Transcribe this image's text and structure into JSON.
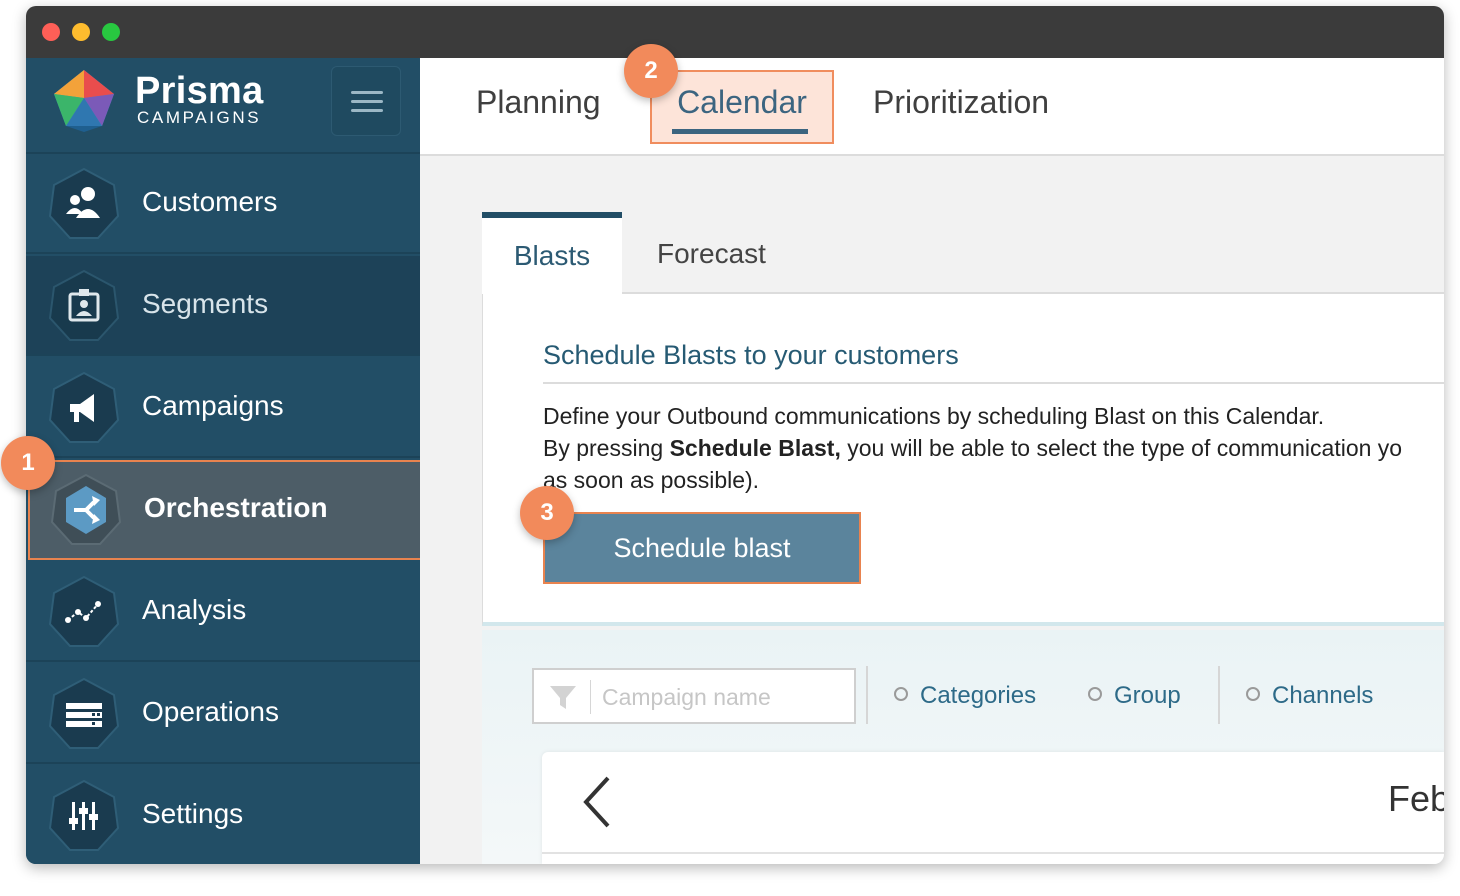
{
  "app": {
    "brand_name": "Prisma",
    "brand_sub": "CAMPAIGNS",
    "colors": {
      "sidebar": "#224e66",
      "accent": "#e8834f",
      "link": "#2d6a88",
      "button": "#5b849c"
    }
  },
  "sidebar": {
    "items": [
      {
        "label": "Customers",
        "icon": "customers-icon"
      },
      {
        "label": "Segments",
        "icon": "segments-icon"
      },
      {
        "label": "Campaigns",
        "icon": "megaphone-icon"
      },
      {
        "label": "Orchestration",
        "icon": "orchestration-icon",
        "active": true
      },
      {
        "label": "Analysis",
        "icon": "analysis-chart-icon"
      },
      {
        "label": "Operations",
        "icon": "operations-icon"
      },
      {
        "label": "Settings",
        "icon": "sliders-icon"
      }
    ]
  },
  "topbar": {
    "tabs": [
      {
        "label": "Planning"
      },
      {
        "label": "Calendar",
        "active": true
      },
      {
        "label": "Prioritization"
      }
    ]
  },
  "subtabs": [
    {
      "label": "Blasts",
      "active": true
    },
    {
      "label": "Forecast"
    }
  ],
  "panel": {
    "title": "Schedule Blasts to your customers",
    "line1": "Define your Outbound communications by scheduling Blast on this Calendar.",
    "line2_pre": "By pressing ",
    "line2_bold": "Schedule Blast,",
    "line2_post": " you will be able to select the type of communication yo",
    "line3": "as soon as possible).",
    "button_label": "Schedule blast"
  },
  "filters": {
    "search_placeholder": "Campaign name",
    "options": [
      "Categories",
      "Group",
      "Channels"
    ]
  },
  "calendar": {
    "month_label": "Feb"
  },
  "badges": [
    "1",
    "2",
    "3"
  ]
}
